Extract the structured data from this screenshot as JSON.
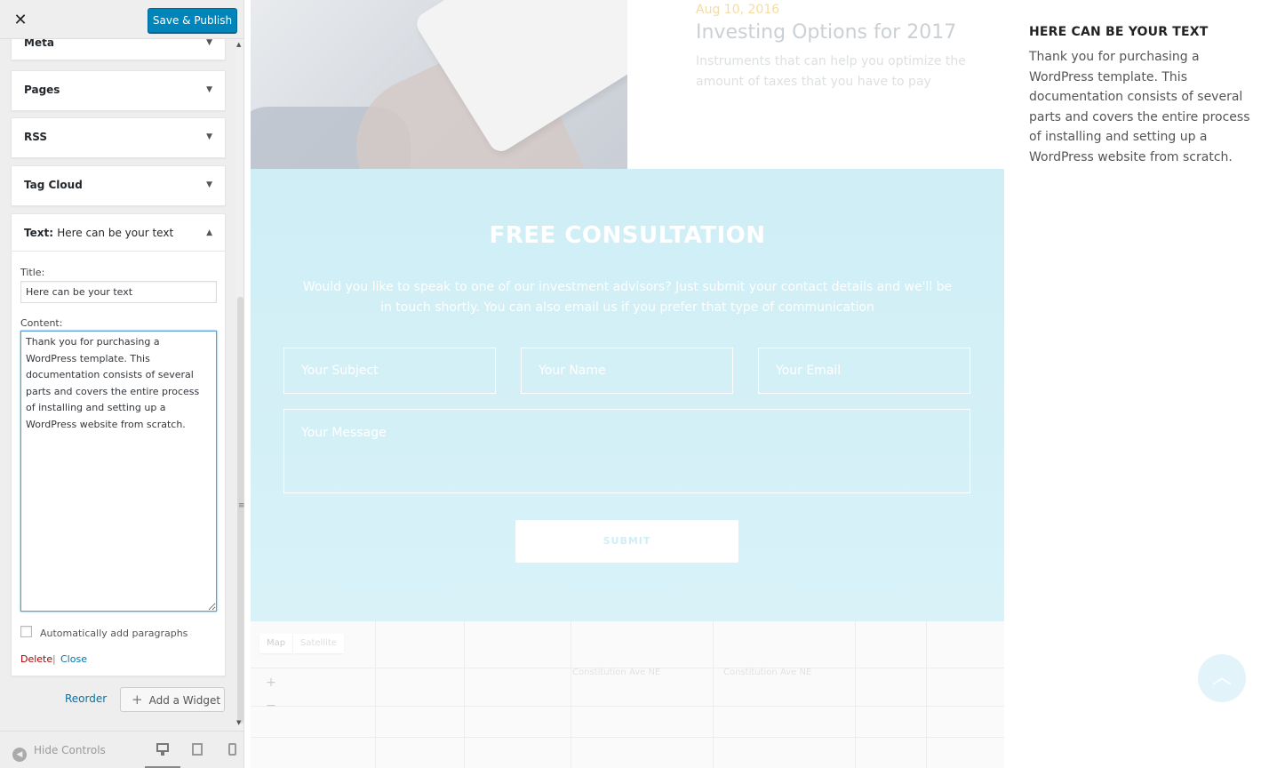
{
  "header": {
    "close_glyph": "✕",
    "publish_label": "Save & Publish"
  },
  "widgets": [
    {
      "title": "Meta"
    },
    {
      "title": "Pages"
    },
    {
      "title": "RSS"
    },
    {
      "title": "Tag Cloud"
    }
  ],
  "text_widget": {
    "title_prefix": "Text:",
    "title_name": "Here can be your text",
    "title_label": "Title:",
    "title_value": "Here can be your text",
    "content_label": "Content:",
    "content_value": "Thank you for purchasing a WordPress template. This documentation consists of several parts and covers the entire process of installing and setting up a WordPress website from scratch.",
    "autop_label": "Automatically add paragraphs",
    "autop_checked": false,
    "delete_label": "Delete",
    "separator": "|",
    "close_label": "Close"
  },
  "sidebar_actions": {
    "reorder_label": "Reorder",
    "add_widget_label": "Add a Widget"
  },
  "footer": {
    "hide_controls_label": "Hide Controls",
    "devices": [
      "desktop-icon",
      "tablet-icon",
      "mobile-icon"
    ]
  },
  "preview": {
    "post": {
      "date": "Aug 10, 2016",
      "title": "Investing Options for 2017",
      "excerpt": "Instruments that can help you optimize the amount of taxes that you have to pay"
    },
    "text_widget": {
      "title": "HERE CAN BE YOUR TEXT",
      "body": "Thank you for purchasing a WordPress template. This documentation consists of several parts and covers the entire process of installing and setting up a WordPress website from scratch."
    },
    "consultation": {
      "title": "FREE CONSULTATION",
      "text": "Would you like to speak to one of our investment advisors? Just submit your contact details and we'll be in touch shortly. You can also email us if you prefer that type of communication",
      "subject_placeholder": "Your Subject",
      "name_placeholder": "Your Name",
      "email_placeholder": "Your Email",
      "message_placeholder": "Your Message",
      "submit_label": "SUBMIT"
    },
    "map": {
      "map_label": "Map",
      "satellite_label": "Satellite",
      "zoom_in": "+",
      "zoom_out": "−",
      "street_1": "Constitution Ave NE",
      "street_2": "Constitution Ave NE"
    }
  },
  "colors": {
    "publish": "#0085ba",
    "link": "#0073aa",
    "delete": "#aa0000",
    "consultation_bg": "#cfeef5"
  }
}
